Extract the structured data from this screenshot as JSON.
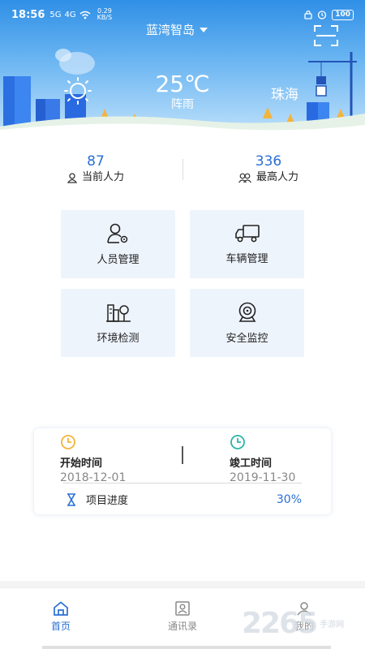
{
  "status_bar": {
    "time": "18:56",
    "signal_1": "5G",
    "signal_2": "4G",
    "net_speed_value": "0.29",
    "net_speed_unit": "KB/S",
    "battery": "100"
  },
  "header": {
    "project_name": "蓝湾智岛",
    "temperature": "25℃",
    "condition": "阵雨",
    "city": "珠海"
  },
  "stats": {
    "current_workforce": {
      "value": "87",
      "label": "当前人力"
    },
    "max_workforce": {
      "value": "336",
      "label": "最高人力"
    }
  },
  "tiles": [
    {
      "label": "人员管理",
      "icon": "personnel-icon"
    },
    {
      "label": "车辆管理",
      "icon": "truck-icon"
    },
    {
      "label": "环境检测",
      "icon": "environment-icon"
    },
    {
      "label": "安全监控",
      "icon": "camera-icon"
    }
  ],
  "progress": {
    "start_label": "开始时间",
    "start_date": "2018-12-01",
    "end_label": "竣工时间",
    "end_date": "2019-11-30",
    "progress_label": "项目进度",
    "progress_value": "30%"
  },
  "tab_bar": {
    "home": "首页",
    "contacts": "通讯录",
    "mine": "我的"
  },
  "watermark": {
    "number": "2265",
    "site": "手游网"
  },
  "colors": {
    "accent": "#2a6fd6",
    "header_top": "#2f8fe6",
    "tile_bg": "#eef4fc",
    "start_icon": "#f3b43a",
    "end_icon": "#2bb5a5"
  }
}
